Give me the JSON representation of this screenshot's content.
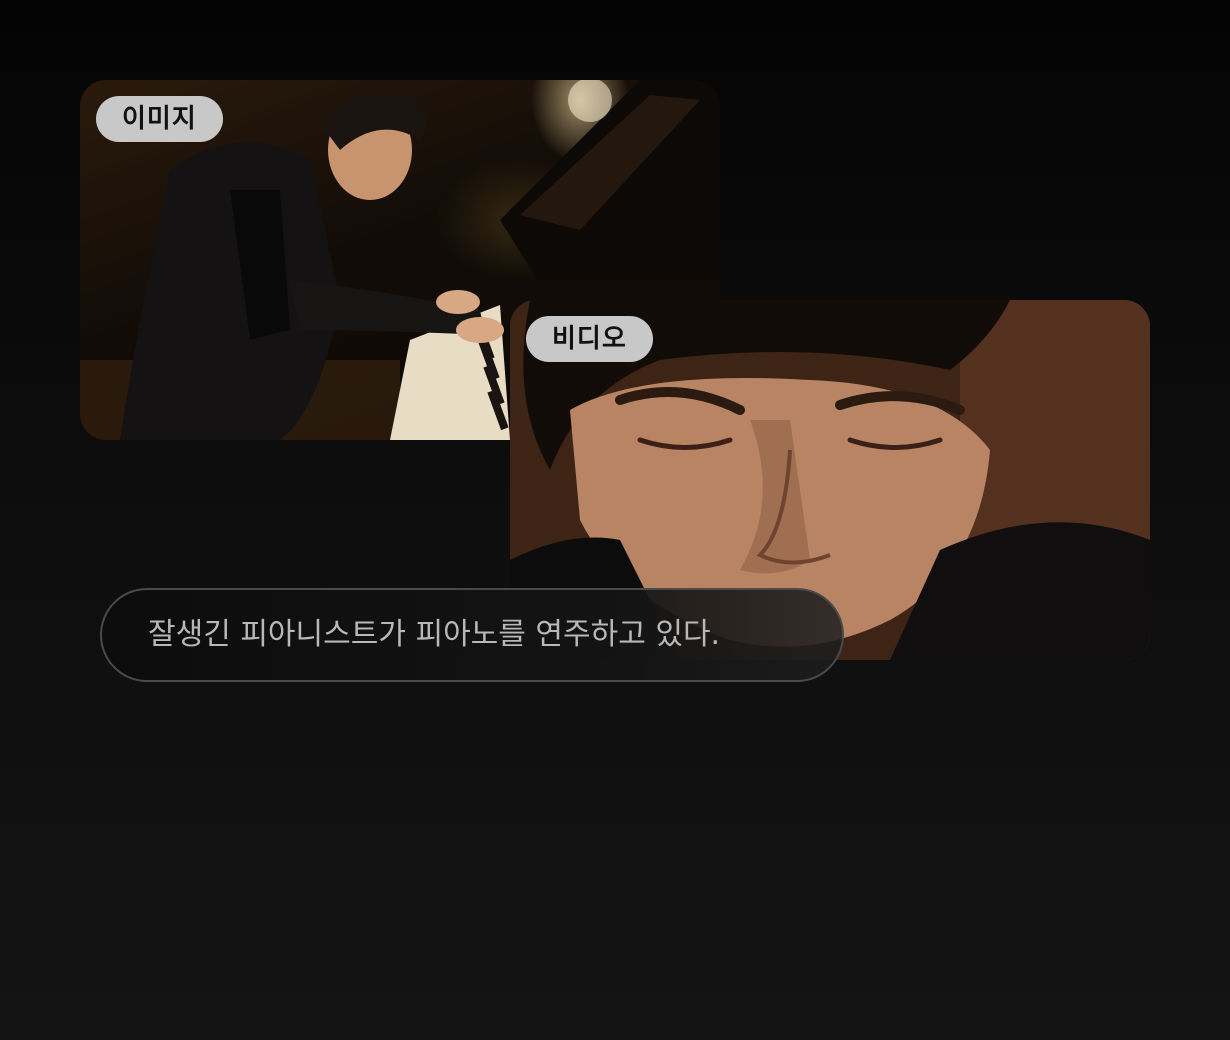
{
  "cards": {
    "image": {
      "badge": "이미지",
      "icon": "piano-player-photo"
    },
    "video": {
      "badge": "비디오",
      "icon": "face-closeup-video-frame"
    }
  },
  "prompt": {
    "text": "잘생긴 피아니스트가 피아노를 연주하고 있다."
  },
  "colors": {
    "background_top": "#040404",
    "background_bottom": "#141414",
    "badge_bg": "#c8c8c8",
    "caption_text": "#b8b8b8",
    "caption_border": "#4a4a4a"
  }
}
